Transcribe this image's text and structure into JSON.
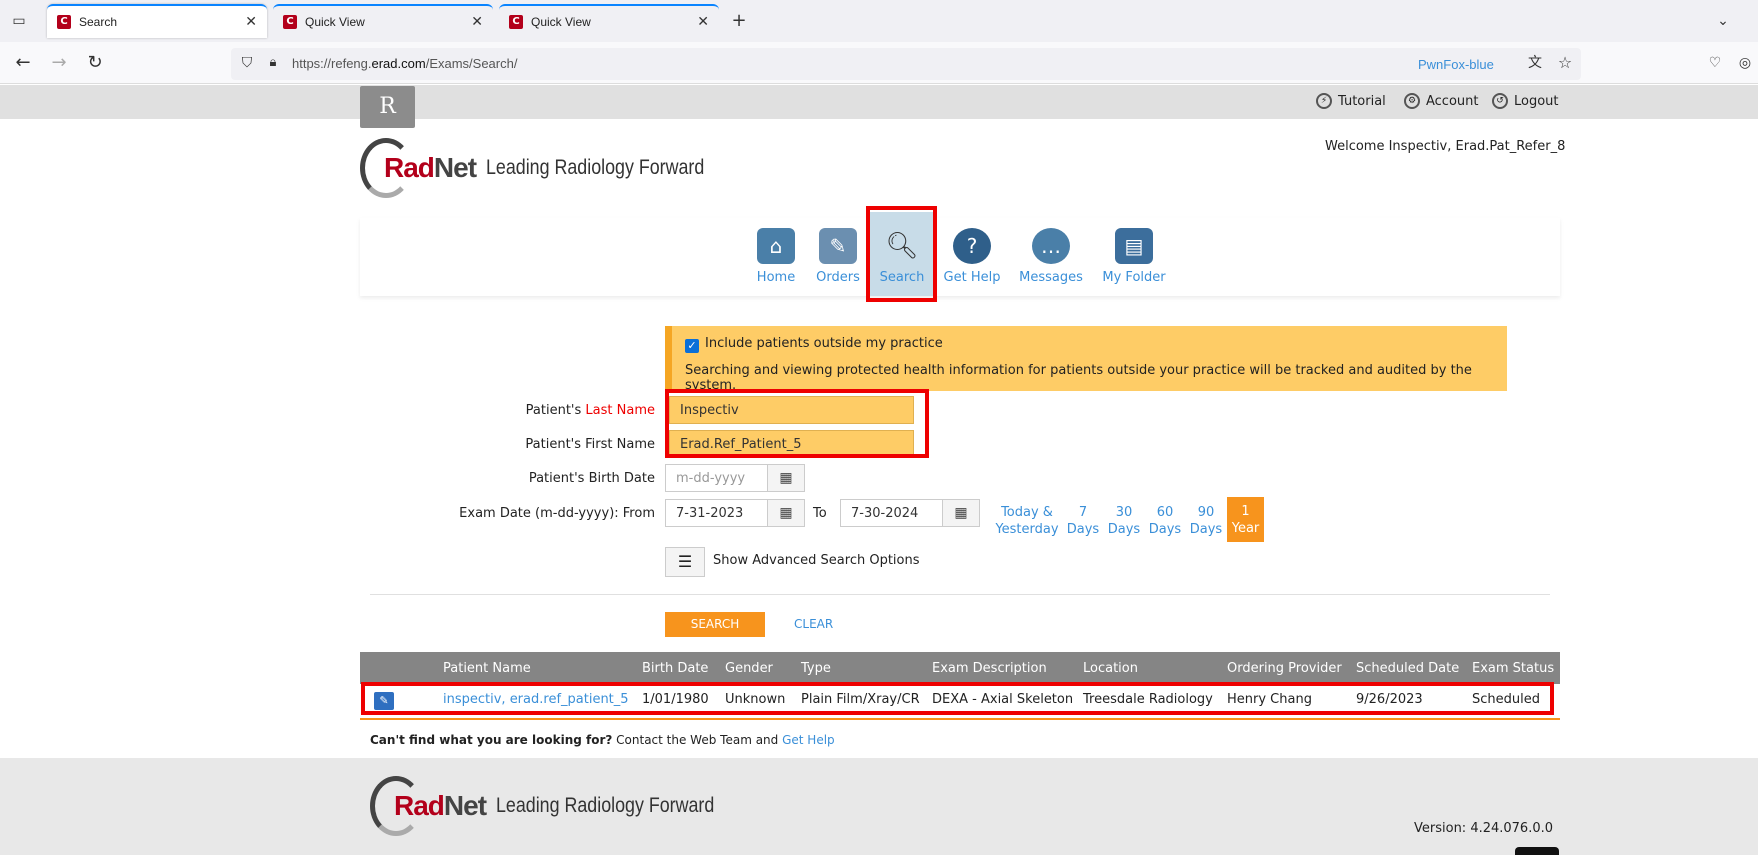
{
  "browser": {
    "tabs": [
      {
        "title": "Search",
        "active": true
      },
      {
        "title": "Quick View",
        "active": false
      },
      {
        "title": "Quick View",
        "active": false
      }
    ],
    "url_prefix": "https://refeng.",
    "url_domain": "erad.com",
    "url_suffix": "/Exams/Search/",
    "container_label": "PwnFox-blue"
  },
  "header": {
    "top_links": {
      "tutorial": "Tutorial",
      "account": "Account",
      "logout": "Logout"
    },
    "welcome": "Welcome Inspectiv, Erad.Pat_Refer_8",
    "logo_rad": "Rad",
    "logo_net": "Net",
    "logo_tagline": "Leading Radiology Forward",
    "r_badge": "R"
  },
  "nav": {
    "home": "Home",
    "orders": "Orders",
    "search": "Search",
    "help": "Get Help",
    "messages": "Messages",
    "folder": "My Folder"
  },
  "search": {
    "include_outside": "Include patients outside my practice",
    "warning": "Searching and viewing protected health information for patients outside your practice will be tracked and audited by the system.",
    "last_name_label_prefix": "Patient's ",
    "last_name_label_red": "Last Name",
    "last_name_value": "Inspectiv",
    "first_name_label": "Patient's First Name",
    "first_name_value": "Erad.Ref_Patient_5",
    "birth_label": "Patient's Birth Date",
    "birth_placeholder": "m-dd-yyyy",
    "exam_date_label": "Exam Date (m-dd-yyyy): From",
    "from_value": "7-31-2023",
    "to_label": "To",
    "to_value": "7-30-2024",
    "quick_ranges": [
      {
        "l1": "Today &",
        "l2": "Yesterday"
      },
      {
        "l1": "7",
        "l2": "Days"
      },
      {
        "l1": "30",
        "l2": "Days"
      },
      {
        "l1": "60",
        "l2": "Days"
      },
      {
        "l1": "90",
        "l2": "Days"
      },
      {
        "l1": "1",
        "l2": "Year"
      }
    ],
    "advanced": "Show Advanced Search Options",
    "search_btn": "SEARCH",
    "clear_btn": "CLEAR"
  },
  "results": {
    "headers": [
      "Patient Name",
      "Birth Date",
      "Gender",
      "Type",
      "Exam Description",
      "Location",
      "Ordering Provider",
      "Scheduled Date",
      "Exam Status"
    ],
    "row": {
      "patient": "inspectiv, erad.ref_patient_5",
      "birth": "1/01/1980",
      "gender": "Unknown",
      "type": "Plain Film/Xray/CR",
      "desc": "DEXA - Axial Skeleton",
      "location": "Treesdale Radiology",
      "provider": "Henry Chang",
      "scheduled": "9/26/2023",
      "status": "Scheduled"
    }
  },
  "help": {
    "bold": "Can't find what you are looking for?",
    "text": " Contact the Web Team and ",
    "link": "Get Help"
  },
  "footer": {
    "version": "Version: 4.24.076.0.0"
  }
}
